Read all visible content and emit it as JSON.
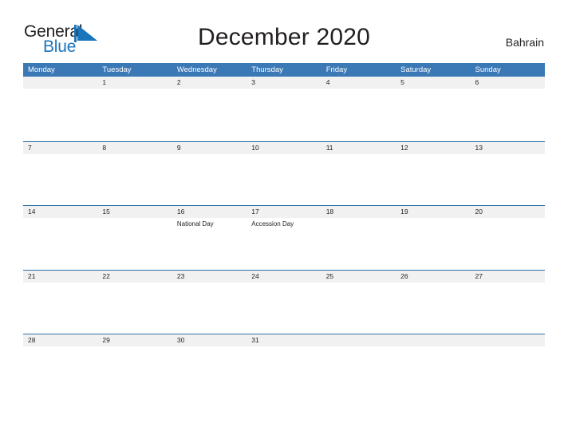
{
  "brand": {
    "name_part1": "General",
    "name_part2": "Blue",
    "flag_icon": "blue-triangle-flag-icon",
    "color_dark": "#231f20",
    "color_blue": "#1b75bb"
  },
  "header": {
    "title": "December 2020",
    "country": "Bahrain"
  },
  "theme": {
    "header_blue": "#3b79b6",
    "row_divider_blue": "#2f6fa8",
    "date_strip_gray": "#f1f1f1",
    "page_background": "#ffffff",
    "text_color": "#231f20"
  },
  "calendar": {
    "month": "December",
    "year": 2020,
    "first_day_of_week": "Monday",
    "day_headers": [
      "Monday",
      "Tuesday",
      "Wednesday",
      "Thursday",
      "Friday",
      "Saturday",
      "Sunday"
    ],
    "weeks": [
      [
        {
          "date": "",
          "event": ""
        },
        {
          "date": "1",
          "event": ""
        },
        {
          "date": "2",
          "event": ""
        },
        {
          "date": "3",
          "event": ""
        },
        {
          "date": "4",
          "event": ""
        },
        {
          "date": "5",
          "event": ""
        },
        {
          "date": "6",
          "event": ""
        }
      ],
      [
        {
          "date": "7",
          "event": ""
        },
        {
          "date": "8",
          "event": ""
        },
        {
          "date": "9",
          "event": ""
        },
        {
          "date": "10",
          "event": ""
        },
        {
          "date": "11",
          "event": ""
        },
        {
          "date": "12",
          "event": ""
        },
        {
          "date": "13",
          "event": ""
        }
      ],
      [
        {
          "date": "14",
          "event": ""
        },
        {
          "date": "15",
          "event": ""
        },
        {
          "date": "16",
          "event": "National Day"
        },
        {
          "date": "17",
          "event": "Accession Day"
        },
        {
          "date": "18",
          "event": ""
        },
        {
          "date": "19",
          "event": ""
        },
        {
          "date": "20",
          "event": ""
        }
      ],
      [
        {
          "date": "21",
          "event": ""
        },
        {
          "date": "22",
          "event": ""
        },
        {
          "date": "23",
          "event": ""
        },
        {
          "date": "24",
          "event": ""
        },
        {
          "date": "25",
          "event": ""
        },
        {
          "date": "26",
          "event": ""
        },
        {
          "date": "27",
          "event": ""
        }
      ],
      [
        {
          "date": "28",
          "event": ""
        },
        {
          "date": "29",
          "event": ""
        },
        {
          "date": "30",
          "event": ""
        },
        {
          "date": "31",
          "event": ""
        },
        {
          "date": "",
          "event": ""
        },
        {
          "date": "",
          "event": ""
        },
        {
          "date": "",
          "event": ""
        }
      ]
    ]
  }
}
